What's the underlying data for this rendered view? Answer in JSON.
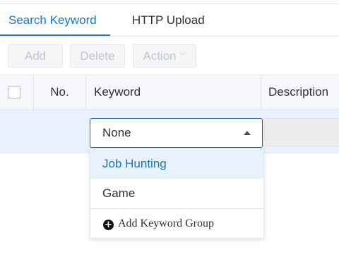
{
  "tabs": [
    {
      "label": "Search Keyword",
      "active": true
    },
    {
      "label": "HTTP Upload",
      "active": false
    }
  ],
  "toolbar": {
    "add_label": "Add",
    "delete_label": "Delete",
    "action_label": "Action"
  },
  "table": {
    "columns": [
      "",
      "No.",
      "Keyword",
      "Description"
    ]
  },
  "keyword_select": {
    "value": "None",
    "options": [
      "Job Hunting",
      "Game"
    ],
    "highlighted_option": "Job Hunting",
    "add_label": "Add Keyword Group"
  },
  "colors": {
    "accent": "#1677d2",
    "row_highlight": "#e8f1fc"
  }
}
